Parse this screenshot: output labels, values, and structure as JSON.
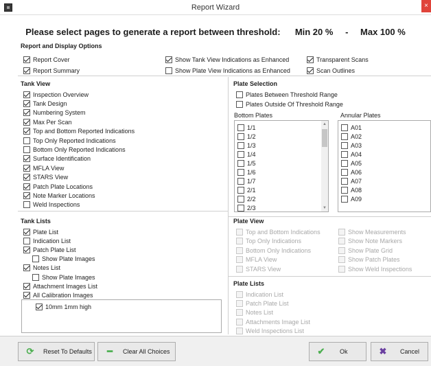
{
  "window": {
    "title": "Report Wizard",
    "close": "×"
  },
  "heading": {
    "prompt": "Please select pages to generate a report between threshold:",
    "min": "Min 20 %",
    "dash": "-",
    "max": "Max 100 %"
  },
  "report_options": {
    "title": "Report and Display Options",
    "items": [
      {
        "label": "Report Cover",
        "checked": true
      },
      {
        "label": "Report Summary",
        "checked": true
      },
      {
        "label": "Show Tank View Indications as Enhanced",
        "checked": true
      },
      {
        "label": "Show Plate View Indications as Enhanced",
        "checked": false
      },
      {
        "label": "Transparent Scans",
        "checked": true
      },
      {
        "label": "Scan Outlines",
        "checked": true
      }
    ]
  },
  "tank_view": {
    "title": "Tank View",
    "items": [
      {
        "label": "Inspection Overview",
        "checked": true
      },
      {
        "label": "Tank Design",
        "checked": true
      },
      {
        "label": "Numbering System",
        "checked": true
      },
      {
        "label": "Max Per Scan",
        "checked": true
      },
      {
        "label": "Top and Bottom Reported Indications",
        "checked": true
      },
      {
        "label": "Top Only Reported Indications",
        "checked": false
      },
      {
        "label": "Bottom Only Reported Indications",
        "checked": false
      },
      {
        "label": "Surface Identification",
        "checked": true
      },
      {
        "label": "MFLA View",
        "checked": true
      },
      {
        "label": "STARS View",
        "checked": true
      },
      {
        "label": "Patch Plate Locations",
        "checked": true
      },
      {
        "label": "Note Marker Locations",
        "checked": true
      },
      {
        "label": "Weld Inspections",
        "checked": false
      }
    ]
  },
  "tank_lists": {
    "title": "Tank Lists",
    "items": [
      {
        "label": "Plate List",
        "checked": true
      },
      {
        "label": "Indication List",
        "checked": false
      },
      {
        "label": "Patch Plate List",
        "checked": true
      },
      {
        "label": "Show Plate Images",
        "checked": false
      },
      {
        "label": "Notes List",
        "checked": true
      },
      {
        "label": "Show Plate Images",
        "checked": false
      },
      {
        "label": "Attachment Images List",
        "checked": true
      },
      {
        "label": "All Calibration Images",
        "checked": true
      }
    ],
    "calibration_items": [
      {
        "label": "10mm 1mm high",
        "checked": true
      }
    ]
  },
  "plate_selection": {
    "title": "Plate Selection",
    "items": [
      {
        "label": "Plates Between Threshold Range",
        "checked": false
      },
      {
        "label": "Plates Outside Of Threshold Range",
        "checked": false
      }
    ],
    "bottom_title": "Bottom Plates",
    "bottom_plates": [
      "1/1",
      "1/2",
      "1/3",
      "1/4",
      "1/5",
      "1/6",
      "1/7",
      "2/1",
      "2/2",
      "2/3"
    ],
    "annular_title": "Annular Plates",
    "annular_plates": [
      "A01",
      "A02",
      "A03",
      "A04",
      "A05",
      "A06",
      "A07",
      "A08",
      "A09"
    ]
  },
  "plate_view": {
    "title": "Plate View",
    "left": [
      "Top and Bottom Indications",
      "Top Only Indications",
      "Bottom Only Indications",
      "MFLA View",
      "STARS View"
    ],
    "right": [
      "Show Measurements",
      "Show Note Markers",
      "Show Plate Grid",
      "Show Patch Plates",
      "Show Weld Inspections"
    ]
  },
  "plate_lists": {
    "title": "Plate Lists",
    "items": [
      "Indication List",
      "Patch Plate List",
      "Notes List",
      "Attachments Image List",
      "Weld Inspections List"
    ]
  },
  "buttons": {
    "reset": "Reset To Defaults",
    "clear": "Clear All Choices",
    "ok": "Ok",
    "cancel": "Cancel"
  },
  "icons": {
    "reset": "refresh-icon",
    "clear": "minus-icon",
    "ok": "check-icon",
    "cancel": "x-icon"
  }
}
